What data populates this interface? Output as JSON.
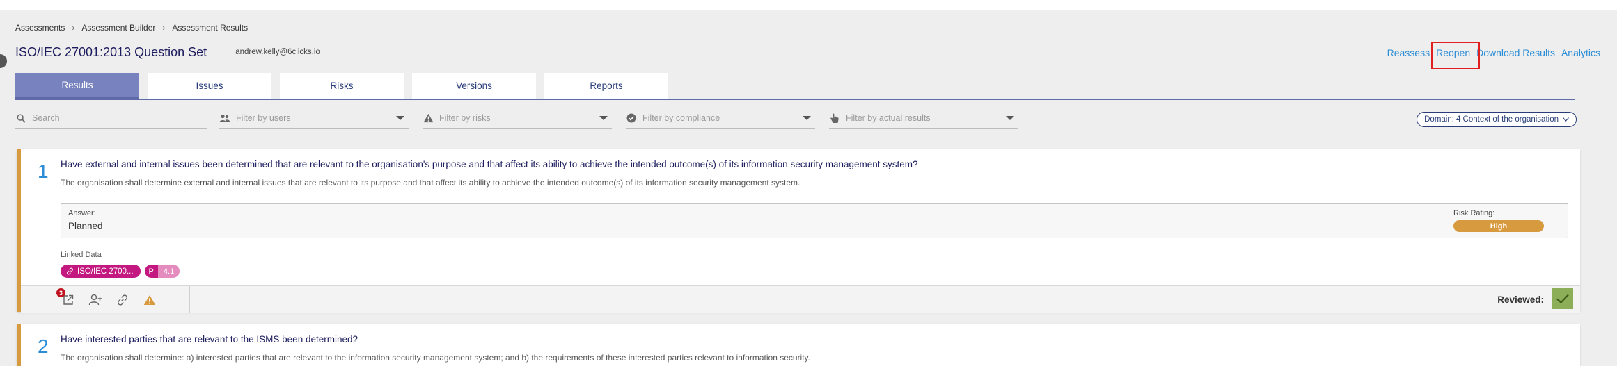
{
  "breadcrumb": [
    "Assessments",
    "Assessment Builder",
    "Assessment Results"
  ],
  "header": {
    "title": "ISO/IEC 27001:2013 Question Set",
    "user_email": "andrew.kelly@6clicks.io"
  },
  "actions": {
    "reassess": "Reassess",
    "reopen": "Reopen",
    "download": "Download Results",
    "analytics": "Analytics"
  },
  "tabs": [
    "Results",
    "Issues",
    "Risks",
    "Versions",
    "Reports"
  ],
  "active_tab": "Results",
  "filters": {
    "search": "Search",
    "users": "Filter by users",
    "risks": "Filter by risks",
    "compliance": "Filter by compliance",
    "actual_results": "Filter by actual results"
  },
  "domain": {
    "label": "Domain:",
    "value": "4 Context of the organisation"
  },
  "questions": [
    {
      "number": "1",
      "title": "Have external and internal issues been determined that are relevant to the organisation's purpose and that affect its ability to achieve the intended outcome(s) of its information security management system?",
      "description": "The organisation shall determine external and internal issues that are relevant to its purpose and that affect its ability to achieve the intended outcome(s) of its information security management system.",
      "answer_label": "Answer:",
      "answer": "Planned",
      "risk_label": "Risk Rating:",
      "risk": "High",
      "linked_label": "Linked Data",
      "linked_chip": "ISO/IEC 2700...",
      "p_tag": "P",
      "p_value": "4.1",
      "issue_count": "3",
      "reviewed_label": "Reviewed:"
    },
    {
      "number": "2",
      "title": "Have interested parties that are relevant to the ISMS been determined?",
      "description": "The organisation shall determine: a) interested parties that are relevant to the information security management system; and b) the requirements of these interested parties relevant to information security."
    }
  ],
  "colors": {
    "accent": "#7782be",
    "link": "#2b8dd6",
    "risk_high": "#d89a3f",
    "chip": "#c2187f",
    "reviewed": "#8cae58"
  }
}
